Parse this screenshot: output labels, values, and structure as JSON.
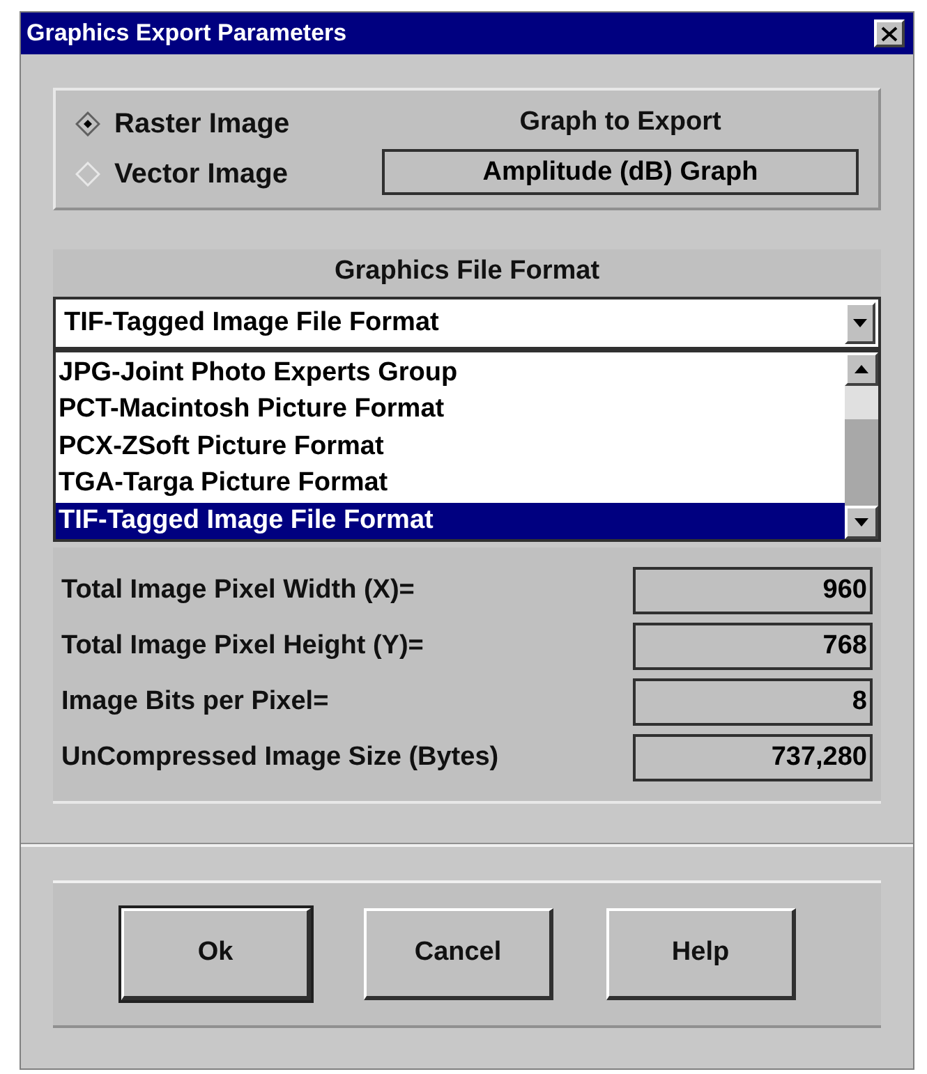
{
  "window": {
    "title": "Graphics Export Parameters"
  },
  "export_type": [
    {
      "label": "Raster Image",
      "selected": true
    },
    {
      "label": "Vector Image",
      "selected": false
    }
  ],
  "graph_to_export": {
    "label": "Graph to Export",
    "value": "Amplitude (dB) Graph"
  },
  "file_format": {
    "label": "Graphics File Format",
    "value": "TIF-Tagged Image File Format",
    "options": [
      {
        "label": "JPG-Joint Photo Experts Group",
        "selected": false
      },
      {
        "label": "PCT-Macintosh Picture Format",
        "selected": false
      },
      {
        "label": "PCX-ZSoft Picture Format",
        "selected": false
      },
      {
        "label": "TGA-Targa Picture Format",
        "selected": false
      },
      {
        "label": "TIF-Tagged Image File Format",
        "selected": true
      }
    ]
  },
  "image_info": [
    {
      "label": "Total Image Pixel Width (X)=",
      "value": "960"
    },
    {
      "label": "Total Image Pixel Height (Y)=",
      "value": "768"
    },
    {
      "label": "Image Bits per Pixel=",
      "value": "8"
    },
    {
      "label": "UnCompressed Image Size (Bytes)",
      "value": "737,280"
    }
  ],
  "buttons": [
    {
      "label": "Ok",
      "default": true
    },
    {
      "label": "Cancel",
      "default": false
    },
    {
      "label": "Help",
      "default": false
    }
  ]
}
